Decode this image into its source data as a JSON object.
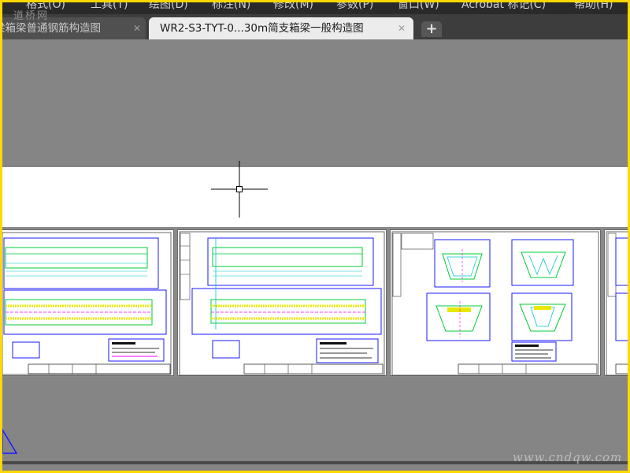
{
  "menu": {
    "items": [
      "格式(O)",
      "工具(T)",
      "绘图(D)",
      "标注(N)",
      "修改(M)",
      "参数(P)",
      "窗口(W)",
      "Acrobat 标记(C)",
      "帮助(H)"
    ]
  },
  "tabs": [
    {
      "label": "梁箱梁普通钢筋构造图",
      "active": false
    },
    {
      "label": "WR2-S3-TYT-0...30m简支箱梁一般构造图",
      "active": true
    }
  ],
  "tab_close_glyph": "✕",
  "new_tab_glyph": "+",
  "watermark": {
    "top": "道桥网",
    "bottom": "www.cndqw.com"
  },
  "colors": {
    "menubar": "#2a2a2a",
    "tabbar": "#3d3d3d",
    "canvas": "#858585",
    "paper": "#ffffff",
    "frame_border": "#ffd800",
    "line_blue": "#1a1aff",
    "line_green": "#00cc33",
    "line_cyan": "#00c8c8",
    "line_yellow": "#e8e800",
    "line_magenta": "#ff00ff"
  },
  "icons": {
    "crosshair": "crosshair-cursor-icon",
    "ucs": "ucs-triangle-icon"
  }
}
